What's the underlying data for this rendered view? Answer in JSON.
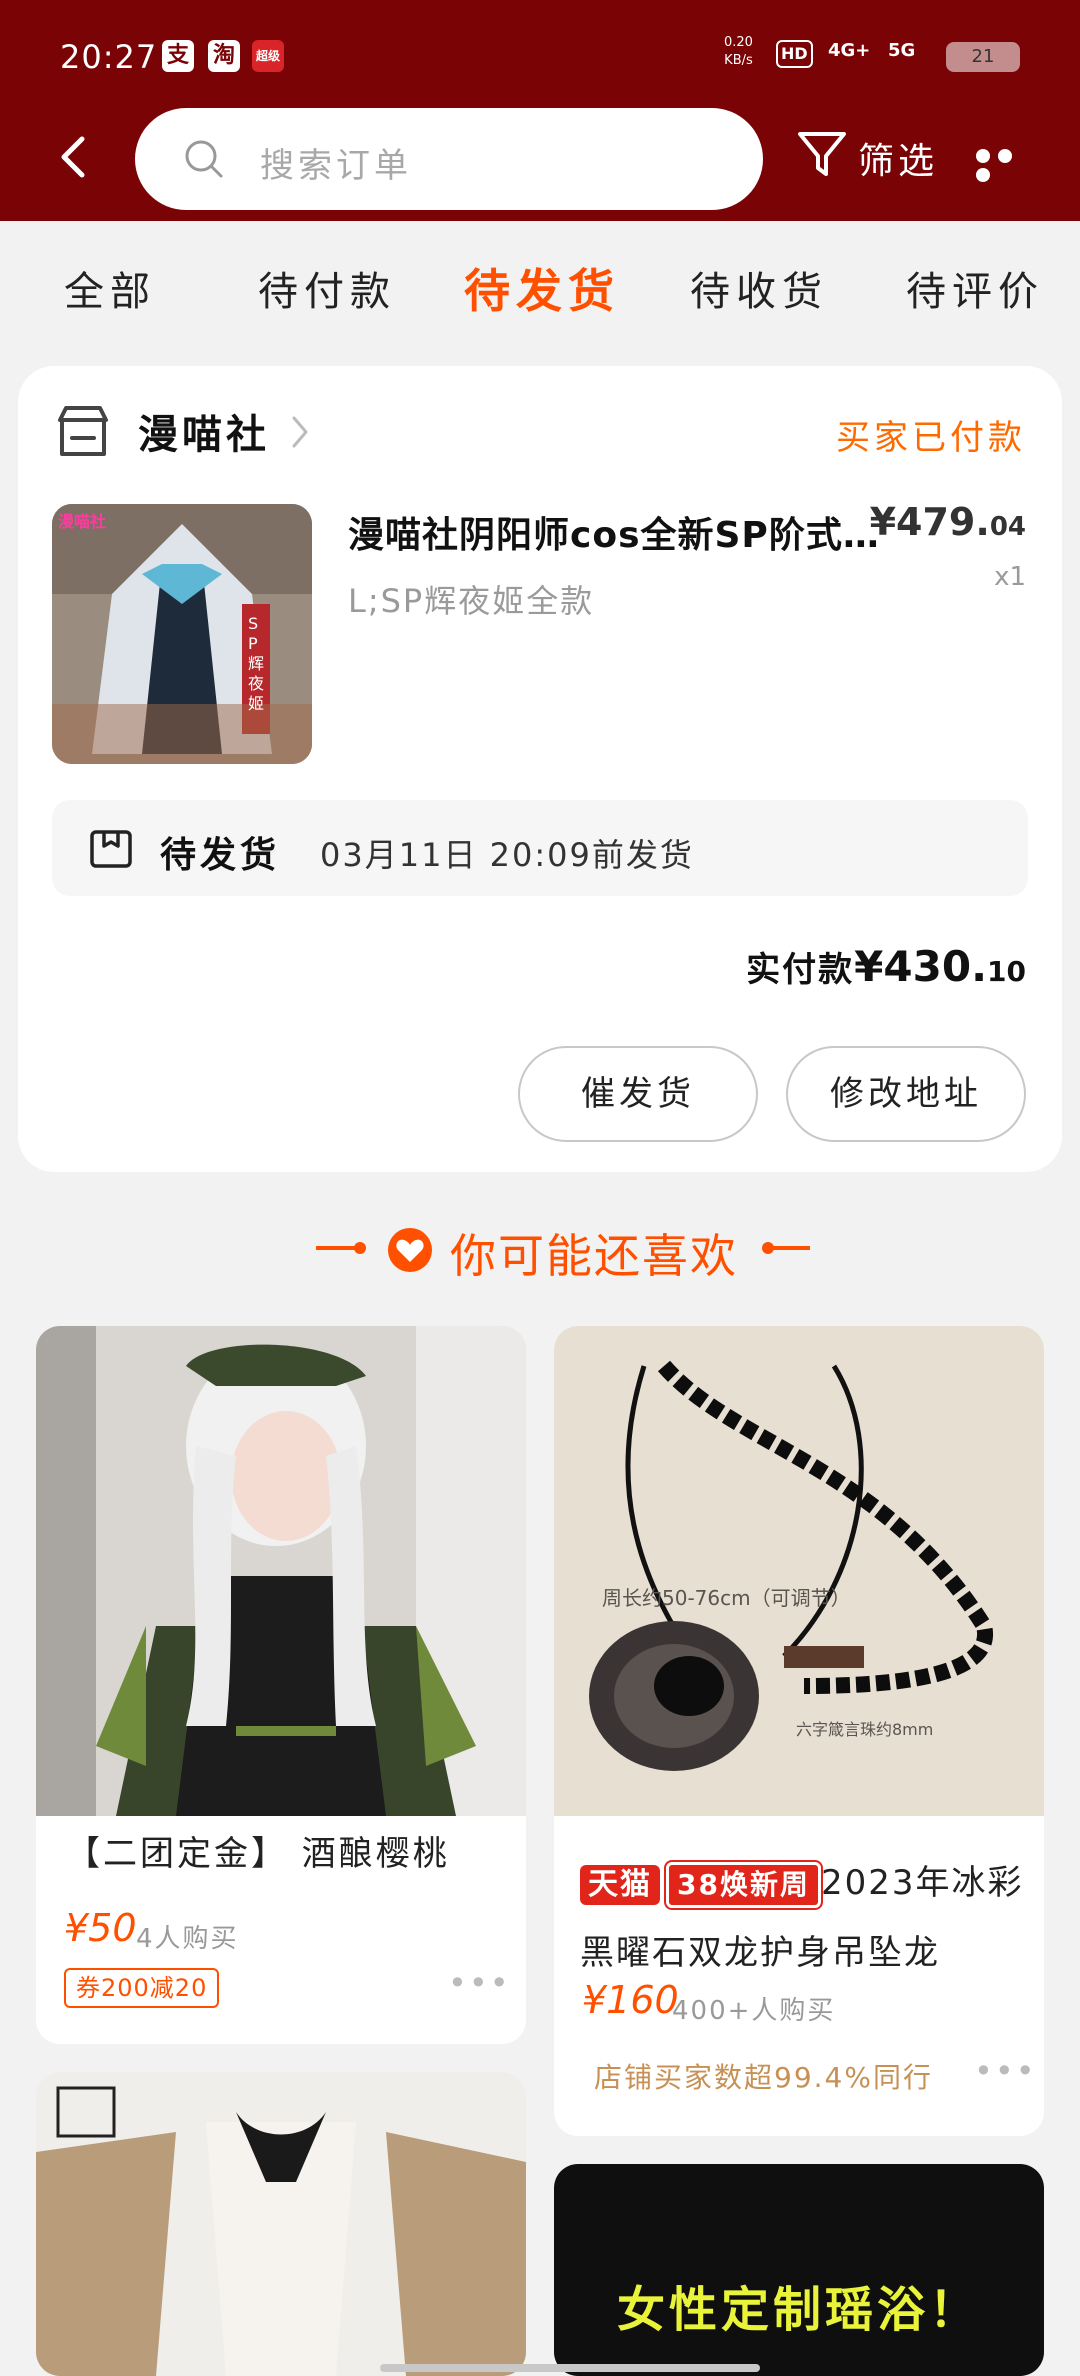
{
  "status_bar": {
    "time": "20:27",
    "apps": [
      "支",
      "淘",
      "超级"
    ],
    "net_speed": "0.20",
    "net_unit": "KB/s",
    "hd": "HD",
    "signal_4g": "4G+",
    "signal_5g": "5G",
    "battery": "21"
  },
  "header": {
    "search_placeholder": "搜索订单",
    "filter_label": "筛选"
  },
  "tabs": [
    {
      "label": "全部",
      "active": false
    },
    {
      "label": "待付款",
      "active": false
    },
    {
      "label": "待发货",
      "active": true
    },
    {
      "label": "待收货",
      "active": false
    },
    {
      "label": "待评价",
      "active": false
    }
  ],
  "order": {
    "shop_name": "漫喵社",
    "status": "买家已付款",
    "product_title": "漫喵社阴阳师cos全新SP阶式神辉夜姬",
    "price_int": "¥479.",
    "price_dec": "04",
    "sku": "L;SP辉夜姬全款",
    "qty": "x1",
    "ship_title": "待发货",
    "ship_text": "03月11日 20:09前发货",
    "paid_label": "实付款",
    "paid_int": "¥430.",
    "paid_dec": "10",
    "buttons": [
      "催发货",
      "修改地址"
    ],
    "product_image_text": "漫喵社",
    "product_image_tag": "SP辉夜姬"
  },
  "recommend": {
    "title": "你可能还喜欢",
    "items": [
      {
        "title": "【二团定金】 酒酿樱桃",
        "price": "¥50",
        "sold": "4人购买",
        "coupon": "券200减20"
      },
      {
        "badge_tmall": "天猫",
        "badge_promo": "38焕新周",
        "title_line1": "2023年冰彩",
        "title_line2": "黑曜石双龙护身吊坠龙",
        "price": "¥160",
        "sold": "400+人购买",
        "shop_note": "店铺买家数超99.4%同行",
        "image_text_1": "周长约50-76cm（可调节）",
        "image_text_2": "六字箴言珠约8mm"
      },
      {
        "dark_text": "女性定制瑶浴！"
      }
    ]
  }
}
